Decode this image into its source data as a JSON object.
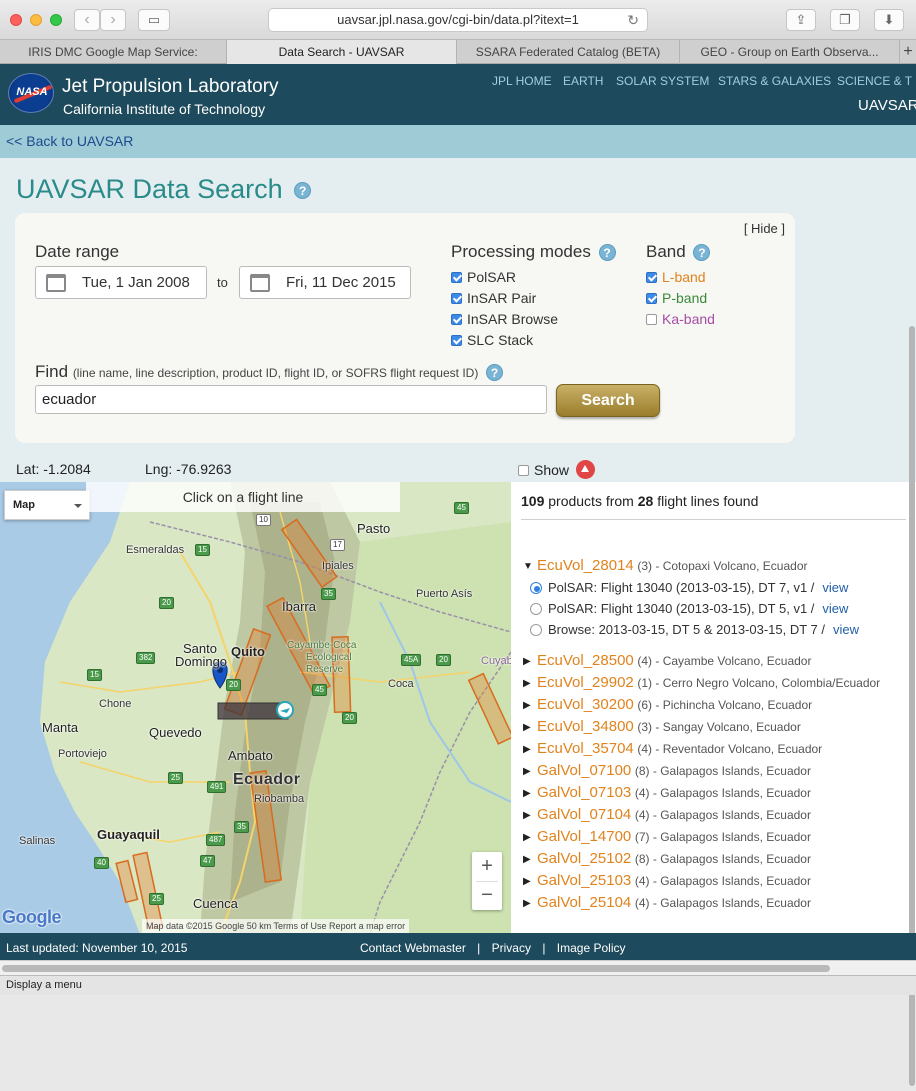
{
  "browser": {
    "url": "uavsar.jpl.nasa.gov/cgi-bin/data.pl?itext=1",
    "tabs": [
      {
        "label": "IRIS DMC Google Map Service:"
      },
      {
        "label": "Data Search - UAVSAR"
      },
      {
        "label": "SSARA Federated Catalog (BETA)"
      },
      {
        "label": "GEO - Group on Earth Observa..."
      }
    ],
    "status": "Display a menu"
  },
  "header": {
    "logo_text": "NASA",
    "title": "Jet Propulsion Laboratory",
    "subtitle": "California Institute of Technology",
    "nav": [
      "JPL HOME",
      "EARTH",
      "SOLAR SYSTEM",
      "STARS & GALAXIES",
      "SCIENCE & T"
    ],
    "section": "UAVSAR"
  },
  "back_link": "<< Back to UAVSAR",
  "page_title": "UAVSAR Data Search",
  "help_glyph": "?",
  "panel": {
    "hide": "[ Hide ]",
    "date_range_label": "Date range",
    "date_from": "Tue, 1 Jan 2008",
    "date_to_sep": "to",
    "date_to": "Fri, 11 Dec 2015",
    "processing_label": "Processing modes",
    "processing_modes": [
      "PolSAR",
      "InSAR Pair",
      "InSAR Browse",
      "SLC Stack"
    ],
    "band_label": "Band",
    "bands": [
      {
        "label": "L-band",
        "checked": true,
        "color": "#e0831d"
      },
      {
        "label": "P-band",
        "checked": true,
        "color": "#3b8a3b"
      },
      {
        "label": "Ka-band",
        "checked": false,
        "color": "#a64ca6"
      }
    ],
    "find_label": "Find",
    "find_hint": "(line name, line description, product ID, flight ID, or SOFRS flight request ID)",
    "find_value": "ecuador",
    "search_button": "Search"
  },
  "coords": {
    "lat": "Lat: -1.2084",
    "lng": "Lng: -76.9263",
    "show": "Show"
  },
  "map": {
    "type_selector": "Map",
    "hint": "Click on a flight line",
    "zoom_in": "+",
    "zoom_out": "−",
    "logo": "Google",
    "footer": "Map data ©2015 Google   50 km   Terms of Use   Report a map error",
    "places": [
      {
        "name": "Esmeraldas"
      },
      {
        "name": "Pasto"
      },
      {
        "name": "Ipiales"
      },
      {
        "name": "Ibarra"
      },
      {
        "name": "Puerto Asís"
      },
      {
        "name": "Santo"
      },
      {
        "name": "Domingo"
      },
      {
        "name": "Quito"
      },
      {
        "name": "Coca"
      },
      {
        "name": "Chone"
      },
      {
        "name": "Manta"
      },
      {
        "name": "Quevedo"
      },
      {
        "name": "Portoviejo"
      },
      {
        "name": "Ambato"
      },
      {
        "name": "Ecuador"
      },
      {
        "name": "Riobamba"
      },
      {
        "name": "Guayaquil"
      },
      {
        "name": "Salinas"
      },
      {
        "name": "Cuenca"
      },
      {
        "name": "Cuyab"
      },
      {
        "name": "Cayambe-Coca"
      },
      {
        "name": "Ecological"
      },
      {
        "name": "Reserve"
      }
    ]
  },
  "results": {
    "count_products": "109",
    "count_mid": " products from ",
    "count_lines": "28",
    "count_suffix": " flight lines found",
    "expanded": {
      "name": "EcuVol_28014",
      "desc": "(3) - Cotopaxi Volcano, Ecuador",
      "items": [
        {
          "label": "PolSAR: Flight 13040 (2013-03-15), DT 7, v1  /",
          "view": "view",
          "selected": true
        },
        {
          "label": "PolSAR: Flight 13040 (2013-03-15), DT 5, v1  /",
          "view": "view",
          "selected": false
        },
        {
          "label": "Browse: 2013-03-15, DT 5 & 2013-03-15, DT 7  /",
          "view": "view",
          "selected": false
        }
      ]
    },
    "lines": [
      {
        "name": "EcuVol_28500",
        "desc": "(4) - Cayambe Volcano, Ecuador"
      },
      {
        "name": "EcuVol_29902",
        "desc": "(1) - Cerro Negro Volcano, Colombia/Ecuador"
      },
      {
        "name": "EcuVol_30200",
        "desc": "(6) - Pichincha Volcano, Ecuador"
      },
      {
        "name": "EcuVol_34800",
        "desc": "(3) - Sangay Volcano, Ecuador"
      },
      {
        "name": "EcuVol_35704",
        "desc": "(4) - Reventador Volcano, Ecuador"
      },
      {
        "name": "GalVol_07100",
        "desc": "(8) - Galapagos Islands, Ecuador"
      },
      {
        "name": "GalVol_07103",
        "desc": "(4) - Galapagos Islands, Ecuador"
      },
      {
        "name": "GalVol_07104",
        "desc": "(4) - Galapagos Islands, Ecuador"
      },
      {
        "name": "GalVol_14700",
        "desc": "(7) - Galapagos Islands, Ecuador"
      },
      {
        "name": "GalVol_25102",
        "desc": "(8) - Galapagos Islands, Ecuador"
      },
      {
        "name": "GalVol_25103",
        "desc": "(4) - Galapagos Islands, Ecuador"
      },
      {
        "name": "GalVol_25104",
        "desc": "(4) - Galapagos Islands, Ecuador"
      }
    ]
  },
  "footer": {
    "updated": "Last updated: November 10, 2015",
    "links": [
      "Contact Webmaster",
      "Privacy",
      "Image Policy"
    ]
  },
  "colors": {
    "header": "#1d4a5c",
    "accent": "#2b8b8b",
    "flight_name": "#e0831d",
    "link": "#1f5ea8"
  }
}
